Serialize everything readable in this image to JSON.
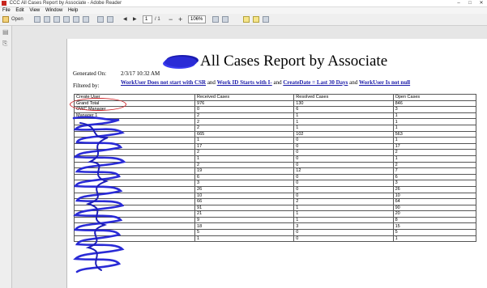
{
  "window": {
    "title": "CCC All Cases Report by Associate - Adobe Reader"
  },
  "menu": [
    "File",
    "Edit",
    "View",
    "Window",
    "Help"
  ],
  "toolbar": {
    "open_label": "Open",
    "page_current": "1",
    "page_total": "/ 1",
    "zoom": "106%"
  },
  "report": {
    "title": "All Cases Report by Associate",
    "generated_label": "Generated On:",
    "generated_value": "2/3/17 10:32 AM",
    "filtered_label": "Filtered by:",
    "filter": {
      "p1": "WorkUser Does not start with CSR",
      "and1": " and ",
      "p2": "Work ID Starts with I-",
      "and2": " and ",
      "p3": "CreateDate = Last 30 Days",
      "and3": " and ",
      "p4": "WorkUser Is not null"
    },
    "columns": [
      "Create User",
      "Received Cases",
      "Resolved Cases",
      "Open Cases"
    ],
    "rows": [
      [
        "Grand Total",
        "976",
        "130",
        "846"
      ],
      [
        "OWC Manager",
        "0",
        "6",
        "3"
      ],
      [
        "Manager 1",
        "2",
        "1",
        "1"
      ],
      [
        "",
        "2",
        "1",
        "1"
      ],
      [
        "",
        "2",
        "1",
        "1"
      ],
      [
        "",
        "665",
        "102",
        "563"
      ],
      [
        "",
        "1",
        "0",
        "1"
      ],
      [
        "",
        "17",
        "0",
        "17"
      ],
      [
        "",
        "2",
        "0",
        "2"
      ],
      [
        "",
        "1",
        "0",
        "1"
      ],
      [
        "",
        "2",
        "0",
        "2"
      ],
      [
        "",
        "19",
        "12",
        "7"
      ],
      [
        "",
        "6",
        "0",
        "6"
      ],
      [
        "",
        "3",
        "0",
        "3"
      ],
      [
        "",
        "26",
        "0",
        "26"
      ],
      [
        "",
        "10",
        "0",
        "10"
      ],
      [
        "",
        "66",
        "2",
        "64"
      ],
      [
        "",
        "91",
        "1",
        "90"
      ],
      [
        "",
        "21",
        "1",
        "20"
      ],
      [
        "",
        "9",
        "1",
        "8"
      ],
      [
        "",
        "18",
        "3",
        "15"
      ],
      [
        "",
        "5",
        "0",
        "5"
      ],
      [
        "",
        "1",
        "0",
        "1"
      ]
    ]
  },
  "colors": {
    "redaction": "#2a2bd6",
    "highlight_circle": "#d0262a",
    "link": "#1a1aa8"
  }
}
